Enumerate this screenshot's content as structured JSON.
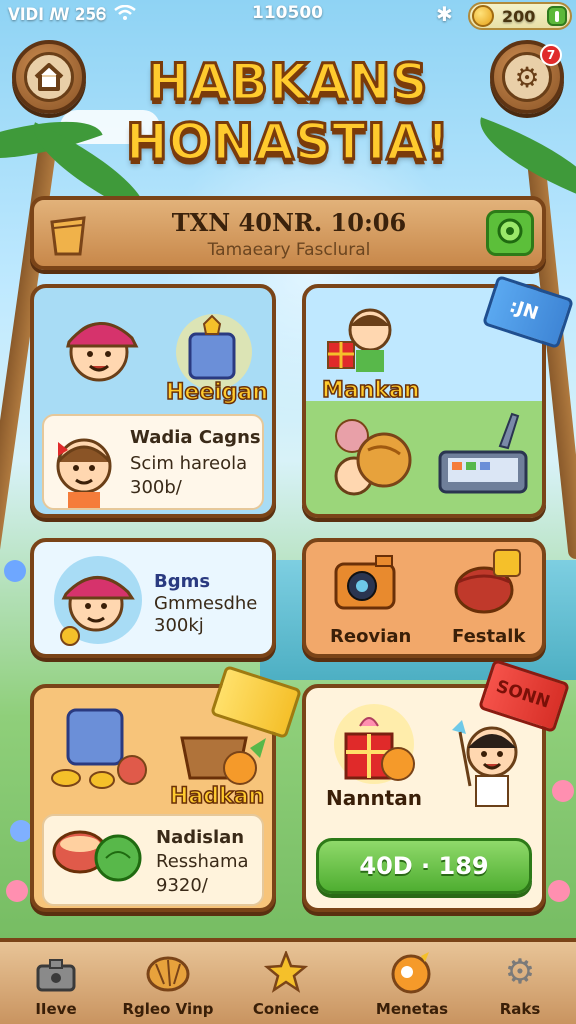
{
  "status_bar": {
    "left": "VIDI ꟿ 25Ꮾ",
    "time": "110500",
    "coins": "200"
  },
  "header": {
    "title_line1": "HABKANS",
    "title_line2": "HONASTIA!",
    "settings_badge": "7"
  },
  "event_banner": {
    "line1": "TXN 40NR. 10:06",
    "line2": "Tamaeary Fasclural"
  },
  "cards": {
    "card1": {
      "top_label": "Heeigan",
      "title": "Wadia Cagns",
      "line1": "Scim hareola",
      "line2": "300b/"
    },
    "card2": {
      "label": "Mankan",
      "ribbon": ":JN"
    },
    "card3": {
      "title": "Bgms",
      "line1": "Gmmesdhe",
      "line2": "300kj"
    },
    "card4": {
      "left_label": "Reovian",
      "right_label": "Festalk"
    },
    "card5": {
      "top_label": "Hadkan",
      "title": "Nadislan",
      "line1": "Resshama",
      "line2": "9320/"
    },
    "card6": {
      "label": "Nanntan",
      "ribbon": "SONN",
      "button": "40D · 189"
    }
  },
  "bottom_nav": [
    {
      "label": "IIeve",
      "icon": "home-icon"
    },
    {
      "label": "Rgleo Vinp",
      "icon": "croissant-icon"
    },
    {
      "label": "Coniece",
      "icon": "star-icon"
    },
    {
      "label": "Menetas",
      "icon": "orange-icon"
    },
    {
      "label": "Raks",
      "icon": "gear-icon"
    }
  ],
  "colors": {
    "wood_border": "#7a4418",
    "gold_text": "#ffcb2e",
    "green_button": "#4fae31",
    "sky": "#8fd3f4"
  }
}
